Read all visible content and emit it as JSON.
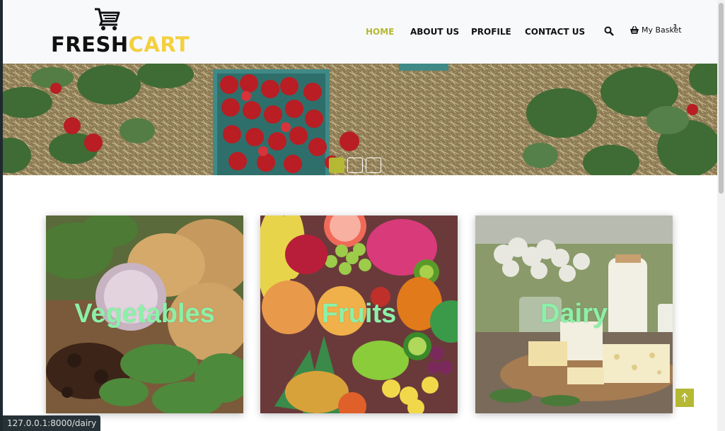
{
  "brand": {
    "part1": "FRESH",
    "part2": "CART",
    "accent": "#f4d03f",
    "icon": "shopping-cart-icon"
  },
  "nav": {
    "items": [
      {
        "label": "HOME",
        "active": true
      },
      {
        "label": "ABOUT US",
        "active": false
      },
      {
        "label": "PROFILE",
        "active": false
      },
      {
        "label": "CONTACT US",
        "active": false
      }
    ],
    "basket_label": "My Basket",
    "basket_count": "3",
    "active_color": "#b5b832"
  },
  "hero": {
    "slides": 3,
    "active_slide": 1
  },
  "categories": [
    {
      "label": "Vegetables"
    },
    {
      "label": "Fruits"
    },
    {
      "label": "Dairy"
    }
  ],
  "status_bar": {
    "url": "127.0.0.1:8000/dairy"
  }
}
